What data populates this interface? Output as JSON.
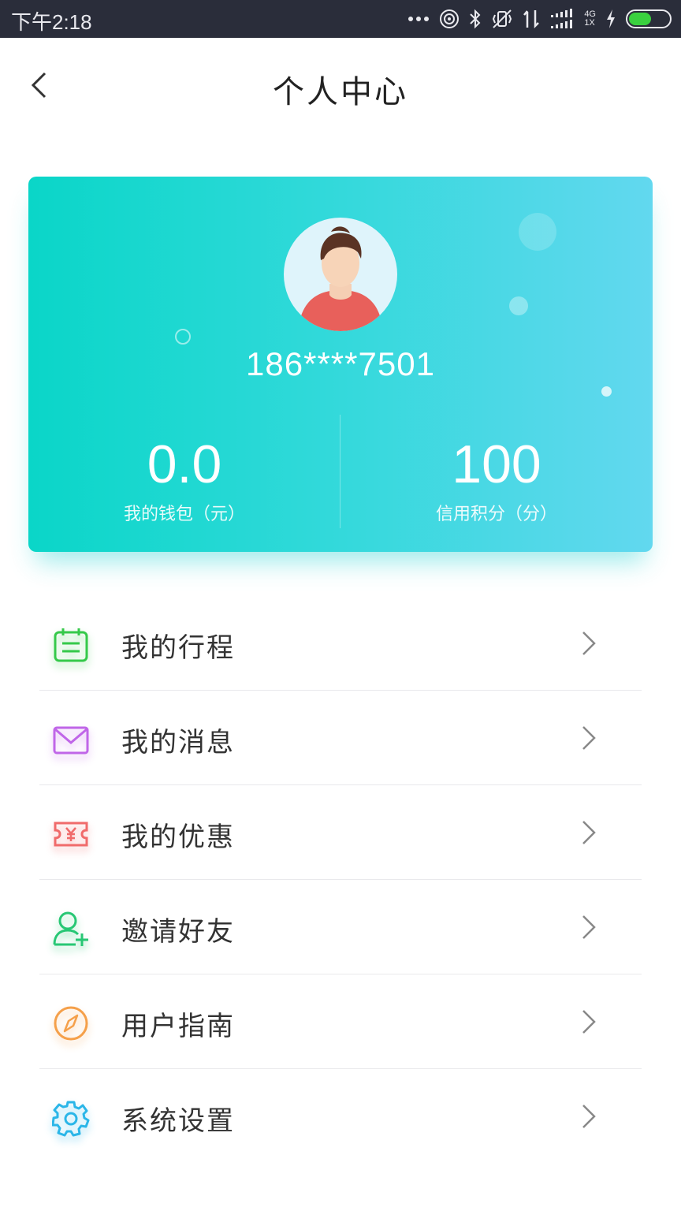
{
  "status_bar": {
    "time": "下午2:18",
    "network_top": "4G",
    "network_bottom": "1X",
    "icons": [
      "more-dots-icon",
      "hotspot-icon",
      "bluetooth-icon",
      "vibrate-icon",
      "data-arrows-icon",
      "signal-icon",
      "network-type-icon",
      "charging-icon",
      "battery-icon"
    ],
    "battery_level": 0.55,
    "battery_color": "#3ad13f"
  },
  "header": {
    "title": "个人中心",
    "back_icon": "chevron-left-icon"
  },
  "profile": {
    "phone": "186****7501",
    "avatar_icon": "user-avatar",
    "wallet": {
      "value": "0.0",
      "label": "我的钱包（元）"
    },
    "credit": {
      "value": "100",
      "label": "信用积分（分）"
    },
    "gradient": [
      "#0ad6c8",
      "#62d8ef"
    ]
  },
  "menu": [
    {
      "label": "我的行程",
      "icon": "calendar-icon",
      "color": "#35c94a"
    },
    {
      "label": "我的消息",
      "icon": "envelope-icon",
      "color": "#c066e8"
    },
    {
      "label": "我的优惠",
      "icon": "coupon-yuan-icon",
      "color": "#f06b6b"
    },
    {
      "label": "邀请好友",
      "icon": "add-user-icon",
      "color": "#27c774"
    },
    {
      "label": "用户指南",
      "icon": "compass-icon",
      "color": "#f5a04a"
    },
    {
      "label": "系统设置",
      "icon": "gear-icon",
      "color": "#2bb6e8"
    }
  ]
}
